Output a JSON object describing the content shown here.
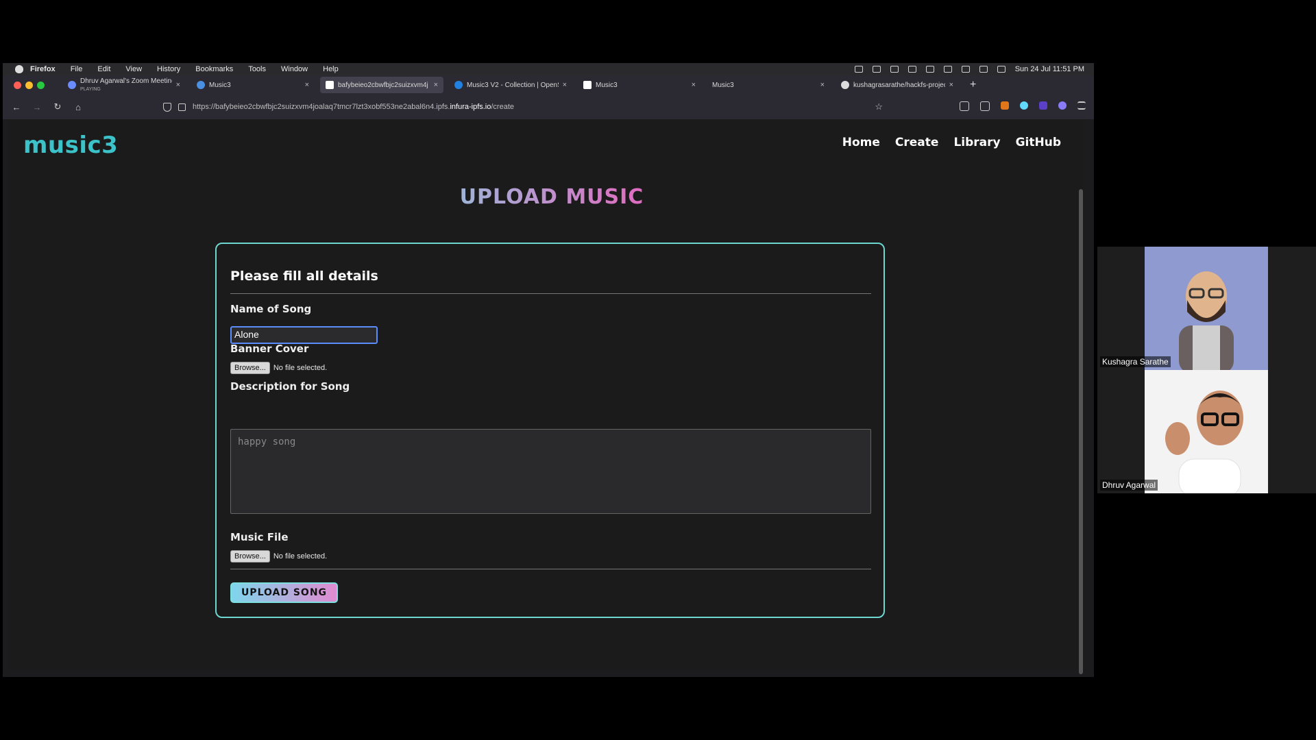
{
  "menubar": {
    "app": "Firefox",
    "items": [
      "File",
      "Edit",
      "View",
      "History",
      "Bookmarks",
      "Tools",
      "Window",
      "Help"
    ],
    "clock": "Sun 24 Jul  11:51 PM"
  },
  "tabs": [
    {
      "title": "Dhruv Agarwal's Zoom Meeting",
      "subtitle": "PLAYING"
    },
    {
      "title": "Music3"
    },
    {
      "title": "bafybeieo2cbwfbjc2suizxvm4j"
    },
    {
      "title": "Music3 V2 - Collection | OpenS"
    },
    {
      "title": "Music3"
    },
    {
      "title": "Music3"
    },
    {
      "title": "kushagrasarathe/hackfs-project"
    }
  ],
  "url": {
    "prefix": "https://bafybeieo2cbwfbjc2suizxvm4joalaq7tmcr7lzt3xobf553ne2abal6n4.ipfs.",
    "domain": "infura-ipfs.io",
    "path": "/create"
  },
  "site": {
    "brand": "music3",
    "nav": [
      "Home",
      "Create",
      "Library",
      "GitHub"
    ]
  },
  "page": {
    "title": "UPLOAD MUSIC",
    "form_heading": "Please fill all details",
    "song_name_label": "Name of Song",
    "song_name_value": "Alone",
    "banner_label": "Banner Cover",
    "browse_label": "Browse...",
    "no_file": "No file selected.",
    "description_label": "Description for Song",
    "description_placeholder": "happy song",
    "music_file_label": "Music File",
    "upload_button": "UPLOAD SONG"
  },
  "participants": [
    {
      "name": "Kushagra Sarathe"
    },
    {
      "name": "Dhruv Agarwal"
    }
  ]
}
